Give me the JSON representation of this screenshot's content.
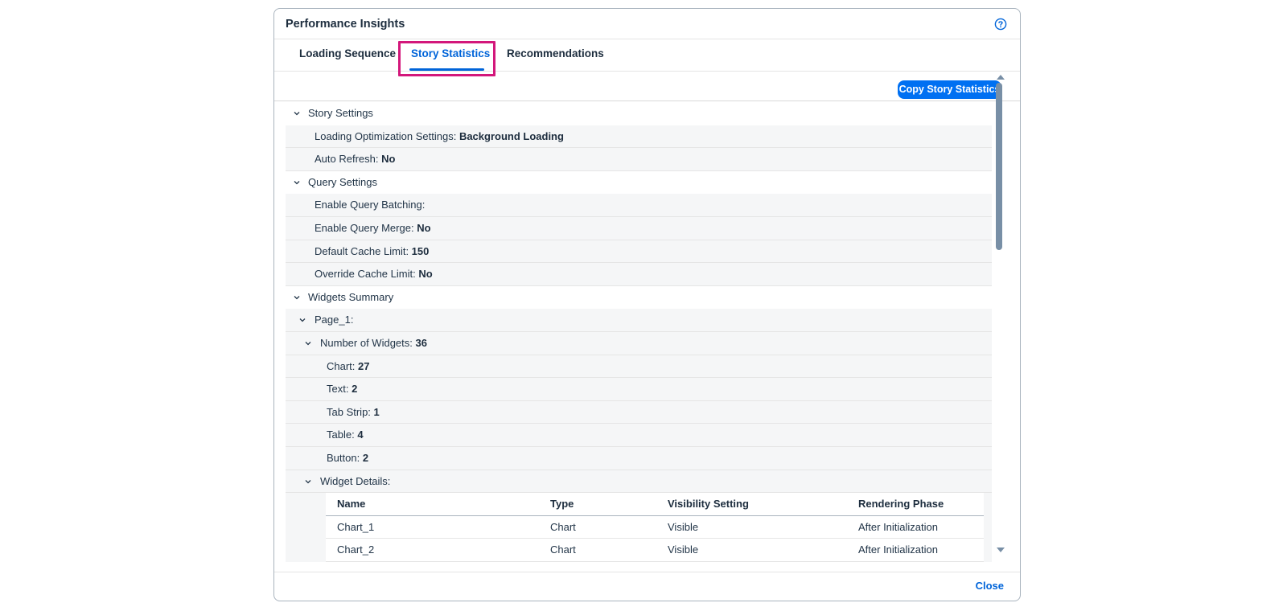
{
  "dialog": {
    "title": "Performance Insights",
    "help_icon": "question-circle-icon",
    "accent_color": "#0064d9",
    "highlight_color": "#d3177b"
  },
  "tabs": [
    {
      "label": "Loading Sequence",
      "selected": false
    },
    {
      "label": "Story Statistics",
      "selected": true
    },
    {
      "label": "Recommendations",
      "selected": false
    }
  ],
  "toolbar": {
    "copy_label": "Copy Story Statistics"
  },
  "story_settings": {
    "label": "Story Settings",
    "items": [
      {
        "label": "Loading Optimization Settings: ",
        "value": "Background Loading"
      },
      {
        "label": "Auto Refresh: ",
        "value": "No"
      }
    ]
  },
  "query_settings": {
    "label": "Query Settings",
    "items": [
      {
        "label": "Enable Query Batching:",
        "value": ""
      },
      {
        "label": "Enable Query Merge: ",
        "value": "No"
      },
      {
        "label": "Default Cache Limit: ",
        "value": "150"
      },
      {
        "label": "Override Cache Limit: ",
        "value": "No"
      }
    ]
  },
  "widgets_summary": {
    "label": "Widgets Summary",
    "page": "Page_1:",
    "number_label": "Number of Widgets: ",
    "number_value": "36",
    "types": [
      {
        "label": "Chart: ",
        "value": "27"
      },
      {
        "label": "Text: ",
        "value": "2"
      },
      {
        "label": "Tab Strip: ",
        "value": "1"
      },
      {
        "label": "Table: ",
        "value": "4"
      },
      {
        "label": "Button: ",
        "value": "2"
      }
    ],
    "details_label": "Widget Details:",
    "table": {
      "columns": [
        "Name",
        "Type",
        "Visibility Setting",
        "Rendering Phase"
      ],
      "rows": [
        [
          "Chart_1",
          "Chart",
          "Visible",
          "After Initialization"
        ],
        [
          "Chart_2",
          "Chart",
          "Visible",
          "After Initialization"
        ]
      ]
    }
  },
  "footer": {
    "close_label": "Close"
  }
}
